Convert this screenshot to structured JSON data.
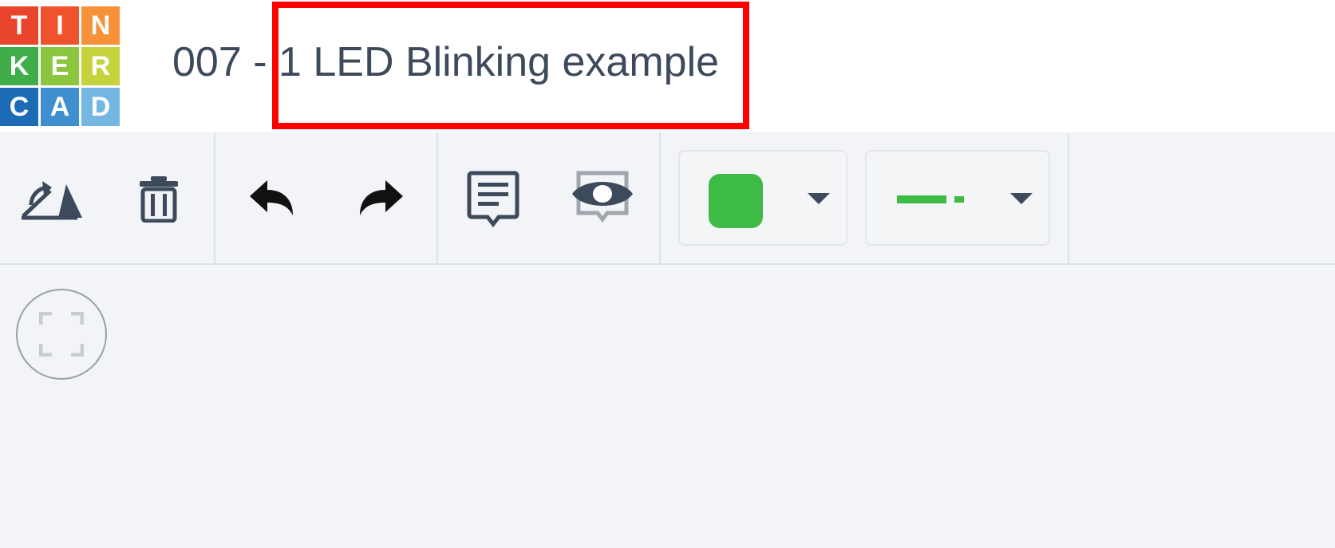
{
  "logo": {
    "letters": [
      "T",
      "I",
      "N",
      "K",
      "E",
      "R",
      "C",
      "A",
      "D"
    ],
    "colors": [
      "#e8452c",
      "#f0532b",
      "#f7923a",
      "#3fae49",
      "#8cc63f",
      "#c6d33c",
      "#1c6cb5",
      "#3e8ed0",
      "#74b7e3"
    ]
  },
  "header": {
    "title": "007 - 1 LED Blinking example"
  },
  "toolbar": {
    "icons": {
      "rotate": "rotate-icon",
      "delete": "trash-icon",
      "undo": "undo-icon",
      "redo": "redo-icon",
      "notes": "notes-icon",
      "visibility": "eye-icon"
    },
    "wire_color": "#3ebb45",
    "wire_color_dropdown": "caret-down-icon",
    "wire_type_dropdown": "caret-down-icon"
  },
  "canvas": {
    "fit_view_icon": "fit-view-icon"
  },
  "highlight": {
    "color": "#ff0000"
  }
}
